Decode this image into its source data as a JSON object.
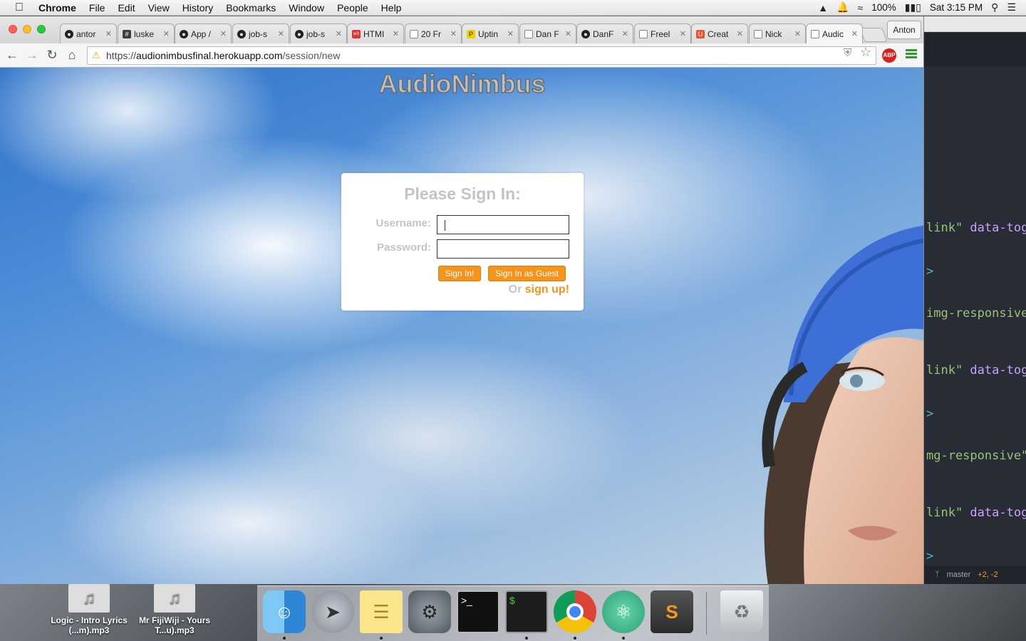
{
  "menubar": {
    "app_name": "Chrome",
    "items": [
      "File",
      "Edit",
      "View",
      "History",
      "Bookmarks",
      "Window",
      "People",
      "Help"
    ],
    "battery": "100%",
    "clock": "Sat 3:15 PM"
  },
  "browser": {
    "tabs": [
      {
        "title": "antor",
        "icon": "github-icon"
      },
      {
        "title": "luske",
        "icon": "slack-icon"
      },
      {
        "title": "App /",
        "icon": "github-icon"
      },
      {
        "title": "job-s",
        "icon": "github-icon"
      },
      {
        "title": "job-s",
        "icon": "github-icon"
      },
      {
        "title": "HTMI",
        "icon": "w3schools-icon"
      },
      {
        "title": "20 Fr",
        "icon": "page-icon"
      },
      {
        "title": "Uptin",
        "icon": "p-icon"
      },
      {
        "title": "Dan F",
        "icon": "page-icon"
      },
      {
        "title": "DanF",
        "icon": "github-icon"
      },
      {
        "title": "Freel",
        "icon": "page-icon"
      },
      {
        "title": "Creat",
        "icon": "u-icon"
      },
      {
        "title": "Nick",
        "icon": "page-icon"
      },
      {
        "title": "Audic",
        "icon": "page-icon"
      }
    ],
    "profile_name": "Anton",
    "url": {
      "protocol": "https://",
      "host": "audionimbusfinal.herokuapp.com",
      "path": "/session/new"
    },
    "abp_label": "ABP"
  },
  "page": {
    "site_title": "AudioNimbus",
    "signin": {
      "heading": "Please Sign In:",
      "username_label": "Username:",
      "password_label": "Password:",
      "username_value": "",
      "password_value": "",
      "signin_button": "Sign In!",
      "guest_button": "Sign In as Guest",
      "or_text": "Or",
      "signup_link": "sign up!"
    }
  },
  "editor": {
    "lines": [
      {
        "a": "link\"",
        "b": " data-tog"
      },
      {
        "a": ">",
        "b": ""
      },
      {
        "a": "img-responsive",
        "b": ""
      },
      {
        "a": "link\"",
        "b": " data-tog"
      },
      {
        "a": ">",
        "b": ""
      },
      {
        "a": "mg-responsive\"",
        "b": ""
      },
      {
        "a": "link\"",
        "b": " data-tog"
      },
      {
        "a": ">",
        "b": ""
      }
    ],
    "branch": "master",
    "diff": "+2, -2"
  },
  "desktop": {
    "files": [
      {
        "name": "Logic - Intro Lyrics (...m).mp3"
      },
      {
        "name": "Mr FijiWiji - Yours T...u).mp3"
      }
    ]
  },
  "dock": {
    "apps": [
      "finder-icon",
      "launchpad-icon",
      "notes-icon",
      "system-preferences-icon",
      "terminal-icon",
      "iterm-icon",
      "chrome-icon",
      "atom-icon",
      "sublime-icon",
      "trash-icon"
    ]
  },
  "colors": {
    "accent_orange": "#f4941c",
    "label_gray": "#c4c4c4",
    "sky_blue": "#2f74c9"
  }
}
